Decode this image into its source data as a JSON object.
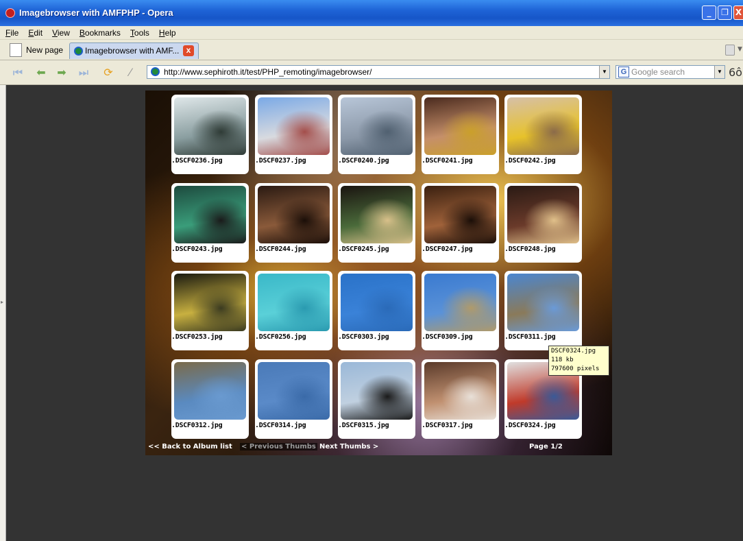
{
  "window": {
    "title": "Imagebrowser with AMFPHP - Opera",
    "min_label": "_",
    "max_label": "❐",
    "close_label": "X"
  },
  "menu": [
    "File",
    "Edit",
    "View",
    "Bookmarks",
    "Tools",
    "Help"
  ],
  "tabs": {
    "new_page": "New page",
    "active": "Imagebrowser with AMF...",
    "close_label": "x"
  },
  "navbar": {
    "url": "http://www.sephiroth.it/test/PHP_remoting/imagebrowser/",
    "search_placeholder": "Google search",
    "search_icon": "G",
    "zoom_label": "6ô"
  },
  "gallery": {
    "thumbnails": [
      {
        "file": ".DSCF0236.jpg",
        "colors": [
          "#dfe7e9",
          "#8a9ea0",
          "#2f3b36"
        ]
      },
      {
        "file": ".DSCF0237.jpg",
        "colors": [
          "#7aa9e6",
          "#d8dadf",
          "#a34d4a"
        ]
      },
      {
        "file": ".DSCF0240.jpg",
        "colors": [
          "#b8c6d8",
          "#8b98a8",
          "#506070"
        ]
      },
      {
        "file": ".DSCF0241.jpg",
        "colors": [
          "#4a2a1e",
          "#c58f6a",
          "#caa02a"
        ]
      },
      {
        "file": ".DSCF0242.jpg",
        "colors": [
          "#d6c0a8",
          "#e7c22a",
          "#8a6a4a"
        ]
      },
      {
        "file": ".DSCF0243.jpg",
        "colors": [
          "#1d4a3e",
          "#3a9d7a",
          "#1a1a1a"
        ]
      },
      {
        "file": ".DSCF0244.jpg",
        "colors": [
          "#2a1a12",
          "#8a5a3a",
          "#1a0e08"
        ]
      },
      {
        "file": ".DSCF0245.jpg",
        "colors": [
          "#1a1410",
          "#4a6a3a",
          "#d8c08a"
        ]
      },
      {
        "file": ".DSCF0247.jpg",
        "colors": [
          "#3a2010",
          "#a0623a",
          "#1a0e08"
        ]
      },
      {
        "file": ".DSCF0248.jpg",
        "colors": [
          "#2a1a14",
          "#6a3a2a",
          "#e0c08a"
        ]
      },
      {
        "file": ".DSCF0253.jpg",
        "colors": [
          "#1a1a10",
          "#c8b040",
          "#3a3a20"
        ]
      },
      {
        "file": ".DSCF0256.jpg",
        "colors": [
          "#3ab8c8",
          "#5ad0d8",
          "#2a9ab0"
        ]
      },
      {
        "file": ".DSCF0303.jpg",
        "colors": [
          "#2a72c8",
          "#3a82d8",
          "#2a6ab8"
        ]
      },
      {
        "file": ".DSCF0309.jpg",
        "colors": [
          "#3a7ad0",
          "#5a92d8",
          "#b09a6a"
        ]
      },
      {
        "file": ".DSCF0311.jpg",
        "colors": [
          "#4a86d0",
          "#8a7a5a",
          "#6a9ad8"
        ]
      },
      {
        "file": ".DSCF0312.jpg",
        "colors": [
          "#7a6a4a",
          "#5a8ac0",
          "#6a9ad0"
        ]
      },
      {
        "file": ".DSCF0314.jpg",
        "colors": [
          "#4a7ab8",
          "#5a8ac8",
          "#3a6aa8"
        ]
      },
      {
        "file": ".DSCF0315.jpg",
        "colors": [
          "#9ab8d8",
          "#c0d0e0",
          "#1a1a1a"
        ]
      },
      {
        "file": ".DSCF0317.jpg",
        "colors": [
          "#5a3a2a",
          "#c09070",
          "#e8e0d8"
        ]
      },
      {
        "file": ".DSCF0324.jpg",
        "colors": [
          "#e0e0e0",
          "#c03a2a",
          "#3a5a98"
        ]
      }
    ],
    "nav": {
      "back": "<< Back to Album list",
      "prev": "< Previous Thumbs",
      "next": "Next Thumbs >",
      "page": "Page 1/2"
    },
    "tooltip": {
      "name": "DSCF0324.jpg",
      "size": "118 kb",
      "pixels": "797600 pixels"
    }
  },
  "colors": {
    "titlebar": "#1e63d6",
    "chrome": "#ece9d8",
    "content_bg": "#333333"
  }
}
